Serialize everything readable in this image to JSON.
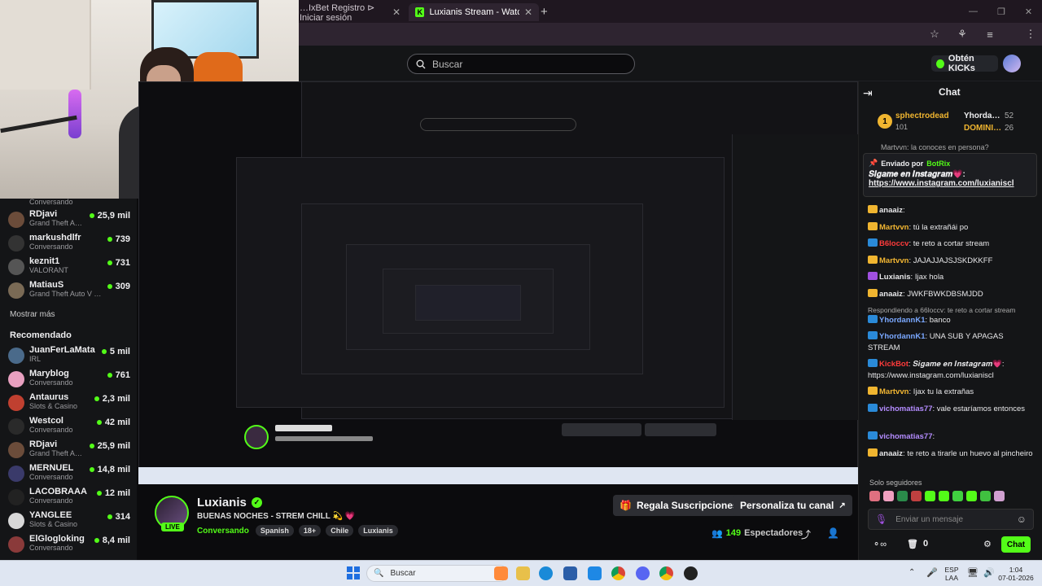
{
  "browser": {
    "tabs": [
      {
        "title": "…IxBet Registro ⊳ Iniciar sesión"
      },
      {
        "title": "Luxianis Stream - Watch Live o"
      }
    ],
    "new_tab": "+"
  },
  "kick": {
    "search_placeholder": "Buscar",
    "kicks_button": "Obtén KICKs"
  },
  "sidebar": {
    "top_status": "Conversando",
    "following": [
      {
        "name": "RDjavi",
        "category": "Grand Theft Auto…",
        "viewers": "25,9 mil",
        "color": "#6b4c3a"
      },
      {
        "name": "markushdlfr",
        "category": "Conversando",
        "viewers": "739",
        "color": "#333"
      },
      {
        "name": "keznit1",
        "category": "VALORANT",
        "viewers": "731",
        "color": "#555"
      },
      {
        "name": "MatiauS",
        "category": "Grand Theft Auto V (G…",
        "viewers": "309",
        "color": "#7a6a55"
      }
    ],
    "show_more": "Mostrar más",
    "recommended_title": "Recomendado",
    "recommended": [
      {
        "name": "JuanFerLaMata",
        "category": "IRL",
        "viewers": "5 mil",
        "color": "#4a6a8a"
      },
      {
        "name": "Maryblog",
        "category": "Conversando",
        "viewers": "761",
        "color": "#e8a0c0"
      },
      {
        "name": "Antaurus",
        "category": "Slots & Casino",
        "viewers": "2,3 mil",
        "color": "#c04030"
      },
      {
        "name": "Westcol",
        "category": "Conversando",
        "viewers": "42 mil",
        "color": "#2a2a2a"
      },
      {
        "name": "RDjavi",
        "category": "Grand Theft Auto…",
        "viewers": "25,9 mil",
        "color": "#6b4c3a"
      },
      {
        "name": "MERNUEL",
        "category": "Conversando",
        "viewers": "14,8 mil",
        "color": "#3a3a6a"
      },
      {
        "name": "LACOBRAAA",
        "category": "Conversando",
        "viewers": "12 mil",
        "color": "#222"
      },
      {
        "name": "YANGLEE",
        "category": "Slots & Casino",
        "viewers": "314",
        "color": "#d8d8d8"
      },
      {
        "name": "ElGlogloking",
        "category": "Conversando",
        "viewers": "8,4 mil",
        "color": "#8a3a3a"
      }
    ]
  },
  "channel": {
    "name": "Luxianis",
    "title": "BUENAS NOCHES - STREM CHILL 💫 💗",
    "category": "Conversando",
    "tags": [
      "Spanish",
      "18+",
      "Chile",
      "Luxianis"
    ],
    "live_label": "LIVE",
    "gift_button": "Regala Suscripciones",
    "customize_button": "Personaliza tu canal",
    "viewers_count": "149",
    "viewers_label": "Espectadores"
  },
  "chat": {
    "title": "Chat",
    "leaderboard": [
      {
        "rank": "1",
        "name": "sphectrodead",
        "points": "101"
      },
      {
        "name": "Yhorda…",
        "points": "52"
      },
      {
        "name": "DOMINI…",
        "points": "26"
      }
    ],
    "pinned_header": "Enviado por",
    "pinned_by": "BotRix",
    "pinned_title": "𝑺𝒊𝒈𝒂𝒎𝒆 𝒆𝒏 𝑰𝒏𝒔𝒕𝒂𝒈𝒓𝒂𝒎💗:",
    "pinned_link": "https://www.instagram.com/luxianiscl",
    "partial_top": "Martvvn: la conoces en persona?",
    "messages": [
      {
        "user": "anaaiz",
        "color": "#e8e8ea",
        "text": ""
      },
      {
        "user": "Martvvn",
        "color": "#f2b632",
        "text": "tú la extrañái po"
      },
      {
        "user": "B6loccv",
        "color": "#ff3b3b",
        "text": "te reto a cortar stream"
      },
      {
        "user": "Martvvn",
        "color": "#f2b632",
        "text": "JAJAJJAJSJSKDKKFF"
      },
      {
        "user": "Luxianis",
        "color": "#e8e8ea",
        "text": "Ijax hola"
      },
      {
        "user": "anaaiz",
        "color": "#e8e8ea",
        "text": "JWKFBWKDBSMJDD"
      },
      {
        "user": "YhordannK1",
        "color": "#7aa8ff",
        "text": "banco"
      },
      {
        "user": "YhordannK1",
        "color": "#7aa8ff",
        "text": "UNA SUB Y APAGAS STREAM"
      },
      {
        "user": "KickBot",
        "color": "#ff3b3b",
        "text": "𝑺𝒊𝒈𝒂𝒎𝒆 𝒆𝒏 𝑰𝒏𝒔𝒕𝒂𝒈𝒓𝒂𝒎💗: https://www.instagram.com/luxianiscl"
      },
      {
        "user": "Martvvn",
        "color": "#f2b632",
        "text": "Ijax tu la extrañas"
      },
      {
        "user": "vichomatias77",
        "color": "#b48cff",
        "text": "vale estaríamos entonces"
      },
      {
        "user": "vichomatias77",
        "color": "#b48cff",
        "text": ""
      },
      {
        "user": "anaaiz",
        "color": "#e8e8ea",
        "text": "te reto a tirarle un huevo al pincheiro"
      }
    ],
    "reply_note": "Respondiendo a 66loccv: te reto a cortar stream",
    "followers_only": "Solo seguidores",
    "input_placeholder": "Enviar un mensaje",
    "points": "0",
    "send_button": "Chat"
  },
  "taskbar": {
    "search": "Buscar",
    "lang_top": "ESP",
    "lang_bottom": "LAA",
    "time": "1:04",
    "date": "07-01-2026"
  },
  "colors": {
    "kick_green": "#53fc18",
    "panel": "#141517",
    "page": "#0b0b0d"
  }
}
